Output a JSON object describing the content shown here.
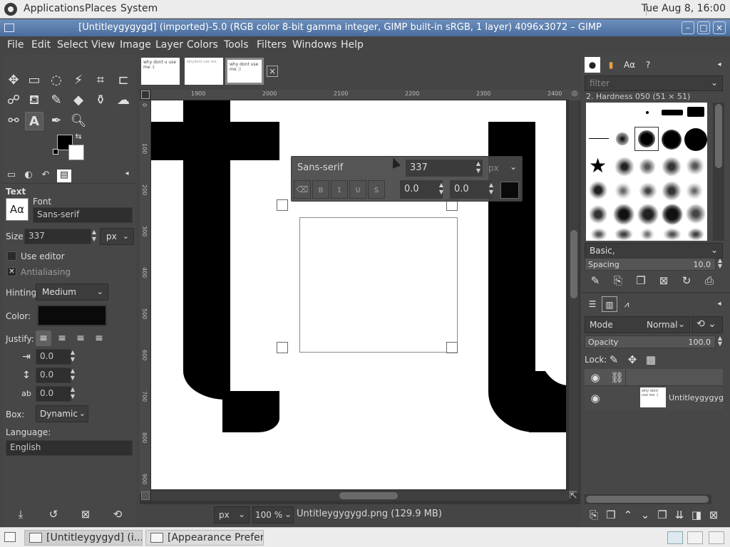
{
  "topbar": {
    "applications": "Applications",
    "places": "Places",
    "system": "System",
    "clock": "Tue Aug  8, 16:00"
  },
  "window": {
    "title": "[Untitleygygygd] (imported)-5.0 (RGB color 8-bit gamma integer, GIMP built-in sRGB, 1 layer) 4096x3072 – GIMP"
  },
  "menubar": [
    "File",
    "Edit",
    "Select",
    "View",
    "Image",
    "Layer",
    "Colors",
    "Tools",
    "Filters",
    "Windows",
    "Help"
  ],
  "thumbs": [
    {
      "text": "why dont u use me :("
    },
    {
      "text": "whydont use me"
    },
    {
      "text": "why dont use me :)"
    }
  ],
  "tool_options": {
    "section_title": "Text",
    "font_label": "Font",
    "font_preview": "Aα",
    "font_value": "Sans-serif",
    "size_label": "Size:",
    "size_value": "337",
    "size_unit": "px",
    "use_editor": "Use editor",
    "antialiasing": "Antialiasing",
    "hinting_label": "Hinting:",
    "hinting_value": "Medium",
    "color_label": "Color:",
    "justify_label": "Justify:",
    "indent_value": "0.0",
    "line_spacing_value": "0.0",
    "letter_spacing_value": "0.0",
    "box_label": "Box:",
    "box_value": "Dynamic",
    "language_label": "Language:",
    "language_value": "English"
  },
  "ruler": {
    "h_ticks": [
      "1900",
      "2000",
      "2100",
      "2200",
      "2300",
      "2400"
    ],
    "v_ticks": [
      "0",
      "100",
      "200",
      "300",
      "400",
      "500",
      "600",
      "700",
      "800",
      "900"
    ]
  },
  "text_toolbar": {
    "font": "Sans-serif",
    "size": "337",
    "unit": "px",
    "baseline": "0.0",
    "kerning": "0.0"
  },
  "statusbar": {
    "unit": "px",
    "zoom": "100 %",
    "file_info": "Untitleygygygd.png (129.9 MB)"
  },
  "brushes": {
    "filter_placeholder": "filter",
    "brush_name": "2. Hardness 050 (51 × 51)",
    "tag_value": "Basic,",
    "spacing_label": "Spacing",
    "spacing_value": "10.0"
  },
  "layers": {
    "mode_label": "Mode",
    "mode_value": "Normal",
    "opacity_label": "Opacity",
    "opacity_value": "100.0",
    "lock_label": "Lock:",
    "layer_name": "Untitleygygygd.png",
    "layer_thumb_text": "why dont use me :)"
  },
  "taskbar": {
    "task1": "[Untitleygygyd] (i...",
    "task2": "[Appearance Prefer..."
  },
  "colors": {
    "titlebar": "#5a7db0",
    "fg": "#000000",
    "bg": "#ffffff"
  }
}
